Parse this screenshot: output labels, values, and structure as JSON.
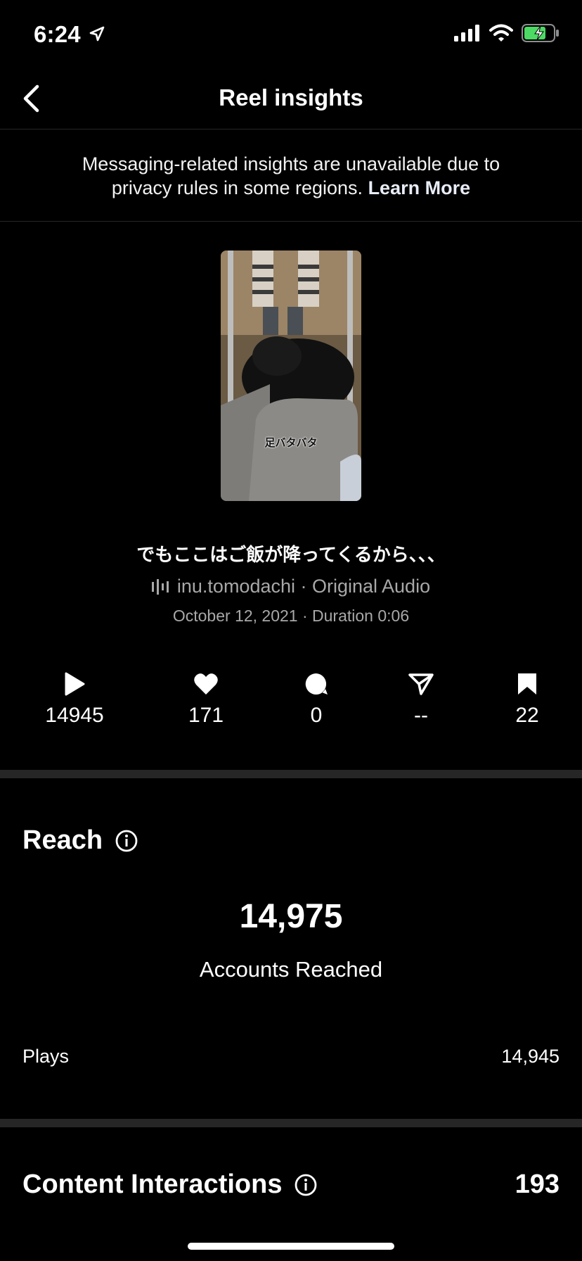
{
  "status_bar": {
    "time": "6:24"
  },
  "nav": {
    "title": "Reel insights"
  },
  "notice": {
    "text": "Messaging-related insights are unavailable due to privacy rules in some regions.",
    "link": "Learn More"
  },
  "reel": {
    "thumbnail_caption": "足バタバタ",
    "caption": "でもここはご飯が降ってくるから、、、",
    "audio": "inu.tomodachi · Original Audio",
    "meta": "October 12, 2021 · Duration 0:06"
  },
  "stats": [
    {
      "icon": "play-icon",
      "value": "14945"
    },
    {
      "icon": "heart-icon",
      "value": "171"
    },
    {
      "icon": "comment-icon",
      "value": "0"
    },
    {
      "icon": "share-icon",
      "value": "--"
    },
    {
      "icon": "bookmark-icon",
      "value": "22"
    }
  ],
  "reach": {
    "title": "Reach",
    "accounts_reached": "14,975",
    "accounts_reached_label": "Accounts Reached",
    "plays_label": "Plays",
    "plays_value": "14,945"
  },
  "content_interactions": {
    "title": "Content Interactions",
    "value": "193"
  }
}
